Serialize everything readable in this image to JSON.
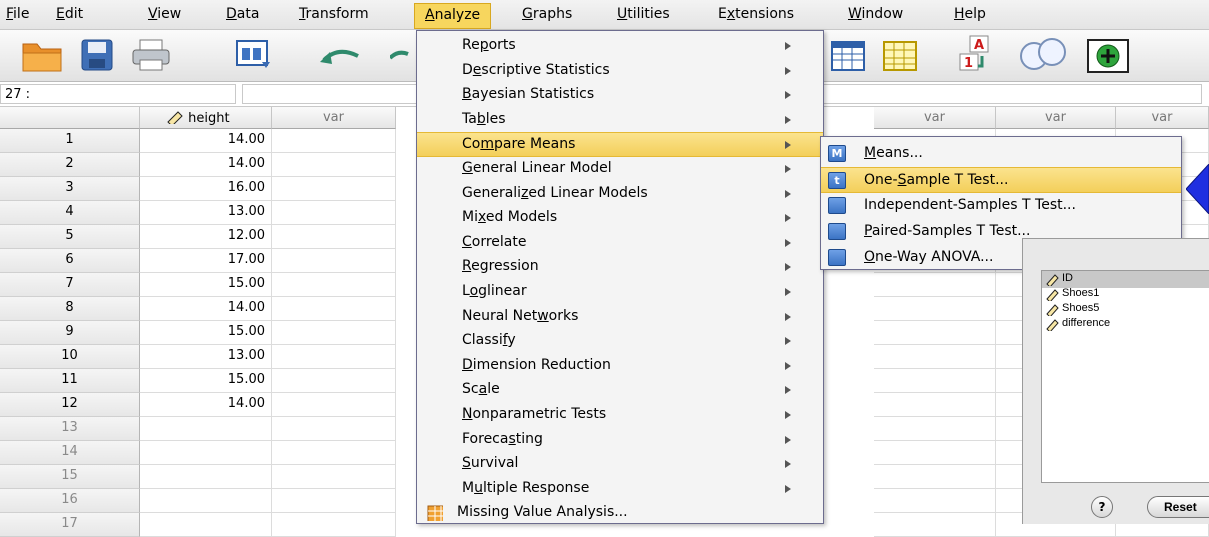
{
  "menubar": {
    "items": [
      {
        "label": "File",
        "mnemonic": "F",
        "rest": "ile"
      },
      {
        "label": "Edit",
        "mnemonic": "E",
        "rest": "dit"
      },
      {
        "label": "View",
        "mnemonic": "V",
        "rest": "iew"
      },
      {
        "label": "Data",
        "mnemonic": "D",
        "rest": "ata"
      },
      {
        "label": "Transform",
        "mnemonic": "T",
        "rest": "ransform"
      },
      {
        "label": "Analyze",
        "mnemonic": "A",
        "rest": "nalyze"
      },
      {
        "label": "Graphs",
        "mnemonic": "G",
        "rest": "raphs"
      },
      {
        "label": "Utilities",
        "mnemonic": "U",
        "rest": "tilities"
      },
      {
        "label": "Extensions",
        "pre": "E",
        "mnemonic": "x",
        "rest": "tensions"
      },
      {
        "label": "Window",
        "mnemonic": "W",
        "rest": "indow"
      },
      {
        "label": "Help",
        "mnemonic": "H",
        "rest": "elp"
      }
    ]
  },
  "toolbar": {
    "icons": [
      "open-folder-icon",
      "save-icon",
      "print-icon",
      "dialog-recall-icon",
      "undo-icon",
      "redo-icon",
      "split-file-icon",
      "select-cases-icon",
      "value-labels-icon",
      "use-variable-sets-icon",
      "spell-check-icon"
    ]
  },
  "cell_ref": {
    "label": "27 :"
  },
  "grid": {
    "columns": [
      {
        "label": "height",
        "is_variable": true
      },
      {
        "label": "var",
        "is_variable": false
      },
      {
        "label": "var",
        "is_variable": false
      },
      {
        "label": "var",
        "is_variable": false
      },
      {
        "label": "var",
        "is_variable": false
      }
    ],
    "rows": [
      {
        "num": "1",
        "height": "14.00"
      },
      {
        "num": "2",
        "height": "14.00"
      },
      {
        "num": "3",
        "height": "16.00"
      },
      {
        "num": "4",
        "height": "13.00"
      },
      {
        "num": "5",
        "height": "12.00"
      },
      {
        "num": "6",
        "height": "17.00"
      },
      {
        "num": "7",
        "height": "15.00"
      },
      {
        "num": "8",
        "height": "14.00"
      },
      {
        "num": "9",
        "height": "15.00"
      },
      {
        "num": "10",
        "height": "13.00"
      },
      {
        "num": "11",
        "height": "15.00"
      },
      {
        "num": "12",
        "height": "14.00"
      },
      {
        "num": "13",
        "height": ""
      },
      {
        "num": "14",
        "height": ""
      },
      {
        "num": "15",
        "height": ""
      },
      {
        "num": "16",
        "height": ""
      },
      {
        "num": "17",
        "height": ""
      }
    ]
  },
  "analyze_menu": {
    "items": [
      {
        "pre": "Re",
        "mn": "p",
        "post": "orts",
        "submenu": true
      },
      {
        "pre": "D",
        "mn": "e",
        "post": "scriptive Statistics",
        "submenu": true
      },
      {
        "pre": "",
        "mn": "B",
        "post": "ayesian Statistics",
        "submenu": true
      },
      {
        "pre": "Ta",
        "mn": "b",
        "post": "les",
        "submenu": true
      },
      {
        "pre": "Co",
        "mn": "m",
        "post": "pare Means",
        "submenu": true,
        "selected": true
      },
      {
        "pre": "",
        "mn": "G",
        "post": "eneral Linear Model",
        "submenu": true
      },
      {
        "pre": "Generali",
        "mn": "z",
        "post": "ed Linear Models",
        "submenu": true
      },
      {
        "pre": "Mi",
        "mn": "x",
        "post": "ed Models",
        "submenu": true
      },
      {
        "pre": "",
        "mn": "C",
        "post": "orrelate",
        "submenu": true
      },
      {
        "pre": "",
        "mn": "R",
        "post": "egression",
        "submenu": true
      },
      {
        "pre": "L",
        "mn": "o",
        "post": "glinear",
        "submenu": true
      },
      {
        "pre": "Neural Net",
        "mn": "w",
        "post": "orks",
        "submenu": true
      },
      {
        "pre": "Classi",
        "mn": "f",
        "post": "y",
        "submenu": true
      },
      {
        "pre": "",
        "mn": "D",
        "post": "imension Reduction",
        "submenu": true
      },
      {
        "pre": "Sc",
        "mn": "a",
        "post": "le",
        "submenu": true
      },
      {
        "pre": "",
        "mn": "N",
        "post": "onparametric Tests",
        "submenu": true
      },
      {
        "pre": "Foreca",
        "mn": "s",
        "post": "ting",
        "submenu": true
      },
      {
        "pre": "",
        "mn": "S",
        "post": "urvival",
        "submenu": true
      },
      {
        "pre": "M",
        "mn": "u",
        "post": "ltiple Response",
        "submenu": true
      },
      {
        "pre": "Missing Value Analysis...",
        "mn": "",
        "post": "",
        "submenu": false,
        "icon": "missing-value-icon"
      }
    ]
  },
  "compare_means_submenu": {
    "items": [
      {
        "pre": "",
        "mn": "M",
        "post": "eans...",
        "icon_letter": "M",
        "color": "#3b73c4"
      },
      {
        "pre": "One-",
        "mn": "S",
        "post": "ample T Test...",
        "icon_letter": "t",
        "color": "#3b73c4",
        "selected": true
      },
      {
        "pre": "Independent-",
        "mn": "",
        "post": "Samples T Test...",
        "icon_letter": "",
        "color": "#3b73c4"
      },
      {
        "pre": "",
        "mn": "P",
        "post": "aired-Samples T Test...",
        "icon_letter": "",
        "color": "#3b73c4"
      },
      {
        "pre": "",
        "mn": "O",
        "post": "ne-Way ANOVA...",
        "icon_letter": "",
        "color": "#3b73c4"
      }
    ]
  },
  "dialog": {
    "variables": [
      "ID",
      "Shoes1",
      "Shoes5",
      "difference"
    ],
    "help_label": "?",
    "reset_label": "Reset"
  },
  "colors": {
    "highlight": "#f3cf5a",
    "menu_border": "#6c6c8e",
    "arrow_blue": "#1f2fe0"
  }
}
